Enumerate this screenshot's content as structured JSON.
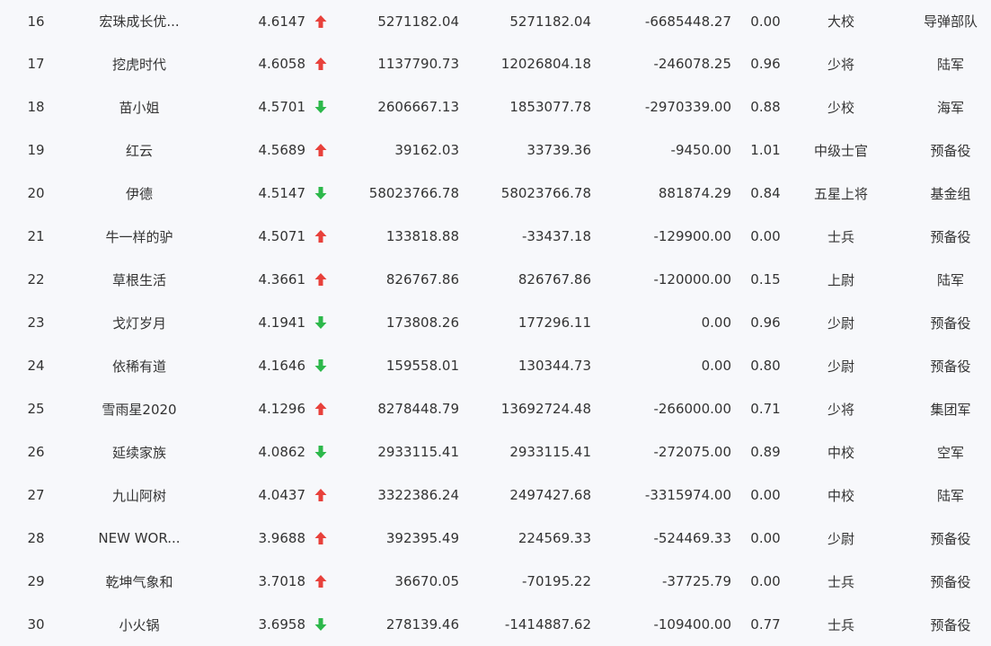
{
  "icons": {
    "up": "arrow-up-icon",
    "down": "arrow-down-icon"
  },
  "colors": {
    "up": "#e8413b",
    "down": "#2db84b",
    "background": "#f7f8fb",
    "text": "#333333"
  },
  "rows": [
    {
      "rank": "16",
      "name": "宏珠成长优...",
      "score": "4.6147",
      "trend": "up",
      "v1": "5271182.04",
      "v2": "5271182.04",
      "v3": "-6685448.27",
      "ratio": "0.00",
      "mil_rank": "大校",
      "branch": "导弹部队"
    },
    {
      "rank": "17",
      "name": "挖虎时代",
      "score": "4.6058",
      "trend": "up",
      "v1": "1137790.73",
      "v2": "12026804.18",
      "v3": "-246078.25",
      "ratio": "0.96",
      "mil_rank": "少将",
      "branch": "陆军"
    },
    {
      "rank": "18",
      "name": "苗小姐",
      "score": "4.5701",
      "trend": "down",
      "v1": "2606667.13",
      "v2": "1853077.78",
      "v3": "-2970339.00",
      "ratio": "0.88",
      "mil_rank": "少校",
      "branch": "海军"
    },
    {
      "rank": "19",
      "name": "红云",
      "score": "4.5689",
      "trend": "up",
      "v1": "39162.03",
      "v2": "33739.36",
      "v3": "-9450.00",
      "ratio": "1.01",
      "mil_rank": "中级士官",
      "branch": "预备役"
    },
    {
      "rank": "20",
      "name": "伊德",
      "score": "4.5147",
      "trend": "down",
      "v1": "58023766.78",
      "v2": "58023766.78",
      "v3": "881874.29",
      "ratio": "0.84",
      "mil_rank": "五星上将",
      "branch": "基金组"
    },
    {
      "rank": "21",
      "name": "牛一样的驴",
      "score": "4.5071",
      "trend": "up",
      "v1": "133818.88",
      "v2": "-33437.18",
      "v3": "-129900.00",
      "ratio": "0.00",
      "mil_rank": "士兵",
      "branch": "预备役"
    },
    {
      "rank": "22",
      "name": "草根生活",
      "score": "4.3661",
      "trend": "up",
      "v1": "826767.86",
      "v2": "826767.86",
      "v3": "-120000.00",
      "ratio": "0.15",
      "mil_rank": "上尉",
      "branch": "陆军"
    },
    {
      "rank": "23",
      "name": "戈灯岁月",
      "score": "4.1941",
      "trend": "down",
      "v1": "173808.26",
      "v2": "177296.11",
      "v3": "0.00",
      "ratio": "0.96",
      "mil_rank": "少尉",
      "branch": "预备役"
    },
    {
      "rank": "24",
      "name": "依稀有道",
      "score": "4.1646",
      "trend": "down",
      "v1": "159558.01",
      "v2": "130344.73",
      "v3": "0.00",
      "ratio": "0.80",
      "mil_rank": "少尉",
      "branch": "预备役"
    },
    {
      "rank": "25",
      "name": "雪雨星2020",
      "score": "4.1296",
      "trend": "up",
      "v1": "8278448.79",
      "v2": "13692724.48",
      "v3": "-266000.00",
      "ratio": "0.71",
      "mil_rank": "少将",
      "branch": "集团军"
    },
    {
      "rank": "26",
      "name": "延续家族",
      "score": "4.0862",
      "trend": "down",
      "v1": "2933115.41",
      "v2": "2933115.41",
      "v3": "-272075.00",
      "ratio": "0.89",
      "mil_rank": "中校",
      "branch": "空军"
    },
    {
      "rank": "27",
      "name": "九山阿树",
      "score": "4.0437",
      "trend": "up",
      "v1": "3322386.24",
      "v2": "2497427.68",
      "v3": "-3315974.00",
      "ratio": "0.00",
      "mil_rank": "中校",
      "branch": "陆军"
    },
    {
      "rank": "28",
      "name": "NEW WOR...",
      "score": "3.9688",
      "trend": "up",
      "v1": "392395.49",
      "v2": "224569.33",
      "v3": "-524469.33",
      "ratio": "0.00",
      "mil_rank": "少尉",
      "branch": "预备役"
    },
    {
      "rank": "29",
      "name": "乾坤气象和",
      "score": "3.7018",
      "trend": "up",
      "v1": "36670.05",
      "v2": "-70195.22",
      "v3": "-37725.79",
      "ratio": "0.00",
      "mil_rank": "士兵",
      "branch": "预备役"
    },
    {
      "rank": "30",
      "name": "小火锅",
      "score": "3.6958",
      "trend": "down",
      "v1": "278139.46",
      "v2": "-1414887.62",
      "v3": "-109400.00",
      "ratio": "0.77",
      "mil_rank": "士兵",
      "branch": "预备役"
    }
  ]
}
